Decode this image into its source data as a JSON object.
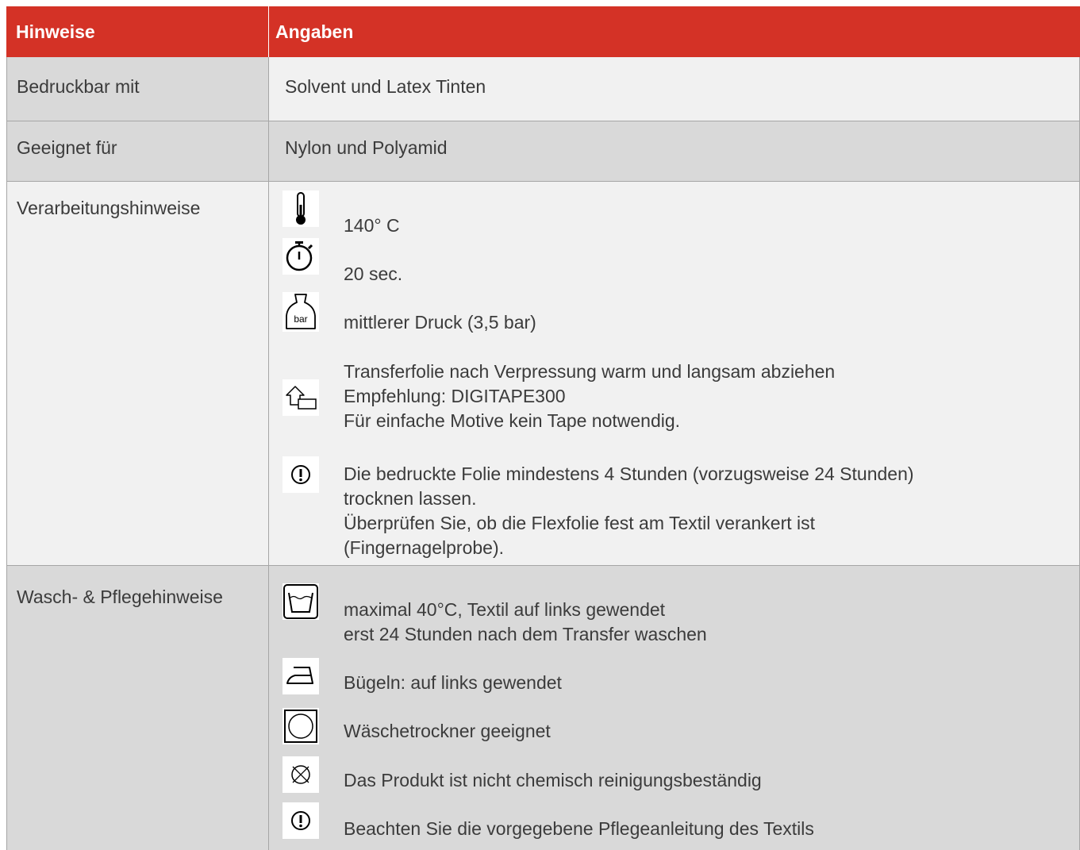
{
  "header": {
    "col1": "Hinweise",
    "col2": "Angaben"
  },
  "rows": {
    "printable": {
      "label": "Bedruckbar mit",
      "value": "Solvent und Latex Tinten"
    },
    "suitable": {
      "label": "Geeignet für",
      "value": "Nylon und Polyamid"
    },
    "processing": {
      "label": "Verarbeitungshinweise",
      "items": [
        {
          "icon": "thermometer-icon",
          "lines": [
            "140° C"
          ]
        },
        {
          "icon": "stopwatch-icon",
          "lines": [
            "20 sec."
          ]
        },
        {
          "icon": "pressure-weight-icon",
          "icon_text": "bar",
          "lines": [
            "mittlerer Druck (3,5 bar)"
          ]
        },
        {
          "icon": "peel-transfer-icon",
          "lines": [
            "Transferfolie nach Verpressung warm und langsam abziehen",
            "Empfehlung: DIGITAPE300",
            "Für einfache Motive kein Tape notwendig."
          ]
        },
        {
          "icon": "attention-icon",
          "lines": [
            "Die bedruckte Folie mindestens 4 Stunden (vorzugsweise 24 Stunden)",
            "trocknen lassen.",
            "Überprüfen Sie, ob die Flexfolie fest am Textil verankert ist",
            "(Fingernagelprobe)."
          ]
        }
      ]
    },
    "care": {
      "label": "Wasch- & Pflegehinweise",
      "items": [
        {
          "icon": "wash-tub-icon",
          "lines": [
            "maximal 40°C, Textil auf links gewendet",
            "erst 24 Stunden nach dem Transfer waschen"
          ]
        },
        {
          "icon": "iron-icon",
          "lines": [
            "Bügeln: auf links gewendet"
          ]
        },
        {
          "icon": "tumble-dryer-icon",
          "lines": [
            "Wäschetrockner geeignet"
          ]
        },
        {
          "icon": "no-dry-cleaning-icon",
          "lines": [
            "Das Produkt ist nicht chemisch reinigungsbeständig"
          ]
        },
        {
          "icon": "attention-icon",
          "lines": [
            "Beachten Sie die vorgegebene Pflegeanleitung des Textils"
          ]
        }
      ]
    }
  },
  "colors": {
    "header_bg": "#d43226",
    "header_text": "#ffffff",
    "row_grey": "#d9d9d9",
    "row_light": "#f1f1f1",
    "border": "#a6a6a6",
    "text": "#3b3b3b"
  }
}
